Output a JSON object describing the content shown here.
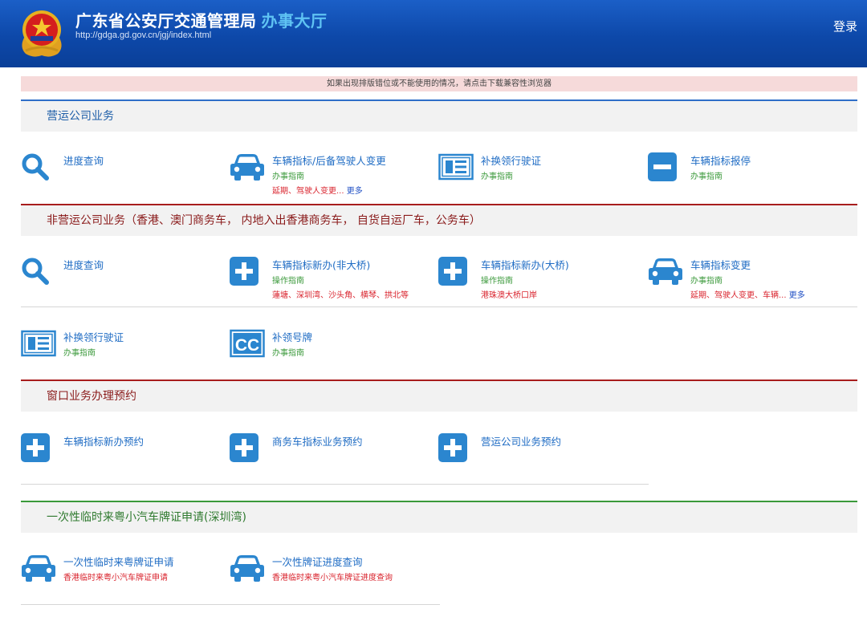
{
  "header": {
    "title": "广东省公安厅交通管理局",
    "title_accent": "办事大厅",
    "url": "http://gdga.gd.gov.cn/jgj/index.html",
    "login": "登录"
  },
  "notice": "如果出现排版错位或不能使用的情况，请点击下载兼容性浏览器",
  "sections": [
    {
      "title": "营运公司业务",
      "color": "#2f6fc9",
      "items": [
        {
          "icon": "search-icon",
          "title": "进度查询"
        },
        {
          "icon": "car-icon",
          "title": "车辆指标/后备驾驶人变更",
          "sub": "办事指南",
          "note": "延期、驾驶人变更...",
          "more": "更多"
        },
        {
          "icon": "document-icon",
          "title": "补换领行驶证",
          "sub": "办事指南"
        },
        {
          "icon": "minus-icon",
          "title": "车辆指标报停",
          "sub": "办事指南"
        }
      ]
    },
    {
      "title": "非营运公司业务（香港、澳门商务车，  内地入出香港商务车，  自货自运厂车，公务车）",
      "color": "#a81d1d",
      "items": [
        {
          "icon": "search-icon",
          "title": "进度查询"
        },
        {
          "icon": "plus-icon",
          "title": "车辆指标新办(非大桥)",
          "sub": "操作指南",
          "note": "蓮塘、深圳湾、沙头角、横琴、拱北等"
        },
        {
          "icon": "plus-icon",
          "title": "车辆指标新办(大桥)",
          "sub": "操作指南",
          "note": "港珠澳大桥口岸"
        },
        {
          "icon": "car-icon",
          "title": "车辆指标变更",
          "sub": "办事指南",
          "note": "延期、驾驶人变更、车辆...",
          "more": "更多"
        },
        {
          "icon": "document-icon",
          "title": "补换领行驶证",
          "sub": "办事指南"
        },
        {
          "icon": "cc-icon",
          "title": "补领号牌",
          "sub": "办事指南"
        }
      ]
    },
    {
      "title": "窗口业务办理预约",
      "color": "#a81d1d",
      "items": [
        {
          "icon": "plus-icon",
          "title": "车辆指标新办预约"
        },
        {
          "icon": "plus-icon",
          "title": "商务车指标业务预约"
        },
        {
          "icon": "plus-icon",
          "title": "营运公司业务预约"
        }
      ]
    },
    {
      "title": "一次性临时来粤小汽车牌证申请(深圳湾)",
      "color": "#3a9a3a",
      "items": [
        {
          "icon": "car-icon",
          "title": "一次性临时来粤牌证申请",
          "sub": "香港临时来粤小汽车牌证申请"
        },
        {
          "icon": "car-icon",
          "title": "一次性牌证进度查询",
          "sub": "香港临时来粤小汽车牌证进度查询"
        }
      ]
    }
  ],
  "colors": {
    "header": "#0d48a9",
    "icon": "#2b86cf",
    "link": "#1f6cc4",
    "guide": "#3c9a3c",
    "note": "#d9232d"
  }
}
